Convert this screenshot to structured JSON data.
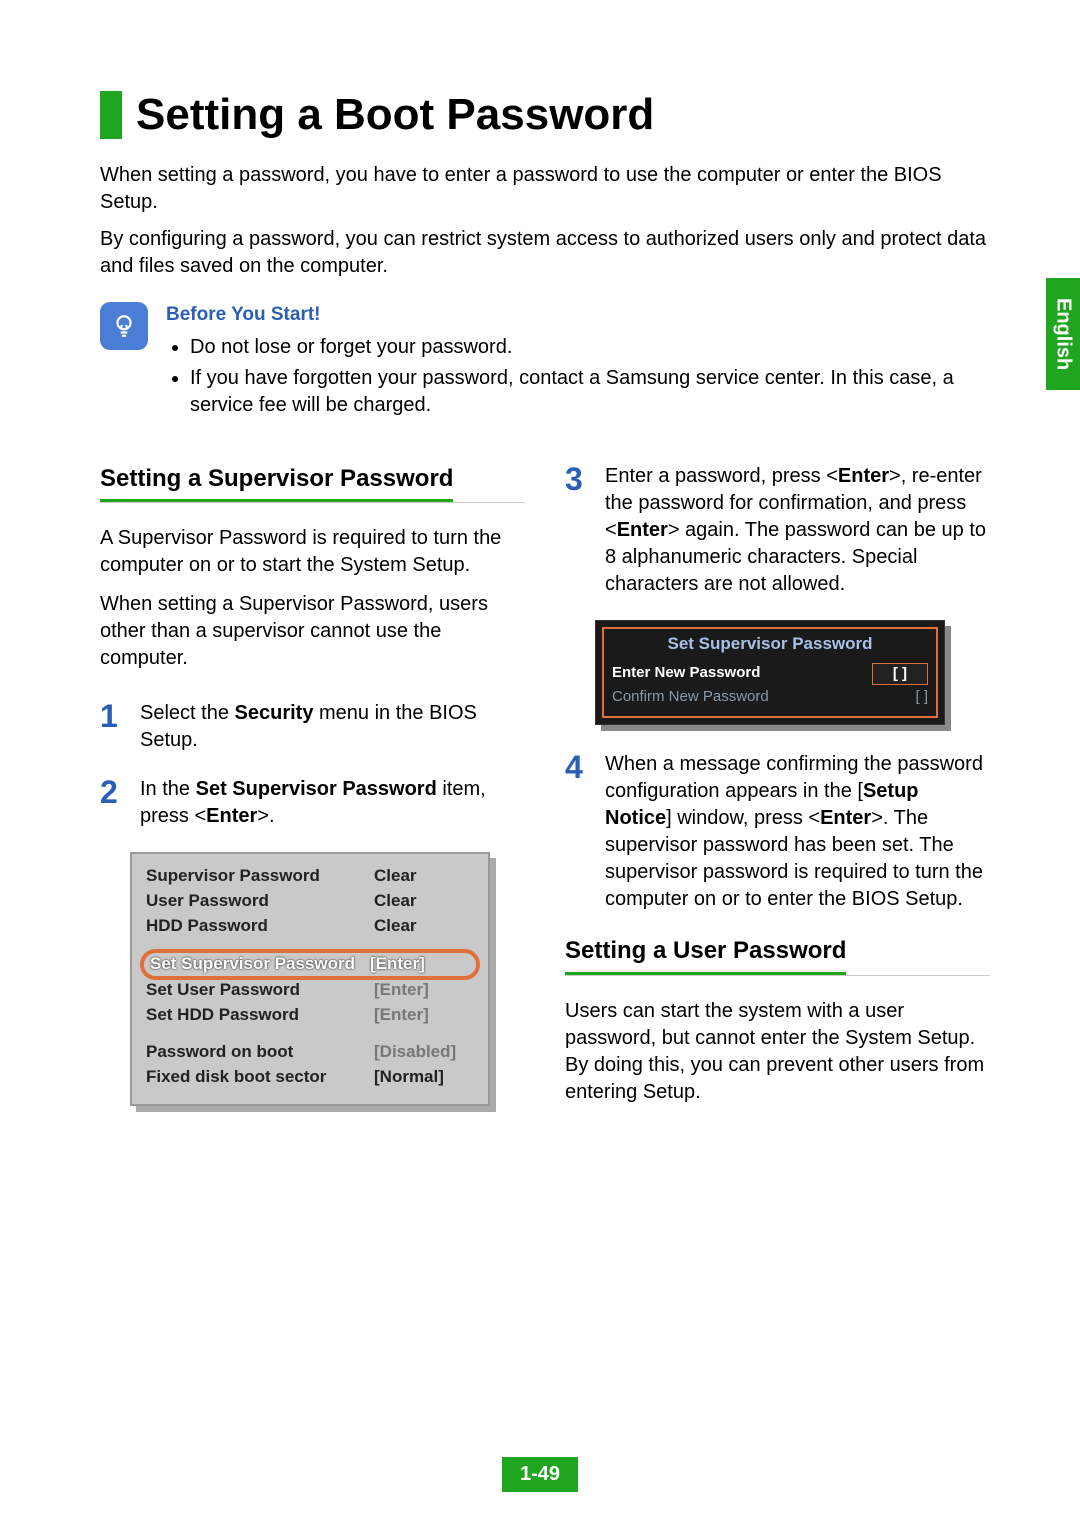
{
  "title": "Setting a Boot Password",
  "intro": {
    "p1": "When setting a password, you have to enter a password to use the computer or enter the BIOS Setup.",
    "p2": "By configuring a password, you can restrict system access to authorized users only and protect data and files saved on the computer."
  },
  "tip": {
    "title": "Before You Start!",
    "b1": "Do not lose or forget your password.",
    "b2": "If you have forgotten your password, contact a Samsung service center. In this case, a service fee will be charged."
  },
  "sideTab": "English",
  "supervisor": {
    "heading": "Setting a Supervisor Password",
    "p1": "A Supervisor Password is required to turn the computer on or to start the System Setup.",
    "p2": "When setting a Supervisor Password, users other than a supervisor cannot use the computer.",
    "step1_a": "Select the ",
    "step1_b": "Security",
    "step1_c": " menu in the BIOS Setup.",
    "step2_a": "In the ",
    "step2_b": "Set Supervisor Password",
    "step2_c": " item, press <",
    "step2_d": "Enter",
    "step2_e": ">."
  },
  "biosFig": {
    "r1l": "Supervisor Password",
    "r1v": "Clear",
    "r2l": "User Password",
    "r2v": "Clear",
    "r3l": "HDD Password",
    "r3v": "Clear",
    "r4l": "Set Supervisor Password",
    "r4v": "[Enter]",
    "r5l": "Set User Password",
    "r5v": "[Enter]",
    "r6l": "Set HDD Password",
    "r6v": "[Enter]",
    "r7l": "Password on boot",
    "r7v": "[Disabled]",
    "r8l": "Fixed disk boot sector",
    "r8v": "[Normal]"
  },
  "right": {
    "step3_a": "Enter a password, press <",
    "step3_b": "Enter",
    "step3_c": ">, re-enter the password for confirmation, and press <",
    "step3_d": "Enter",
    "step3_e": "> again. The password can be up to 8 alphanumeric characters. Special characters are not allowed.",
    "step4_a": "When a message confirming the password configuration appears in the [",
    "step4_b": "Setup Notice",
    "step4_c": "] window, press <",
    "step4_d": "Enter",
    "step4_e": ">. The supervisor password has been set. The supervisor password is required to turn the computer on or to enter the BIOS Setup."
  },
  "dialog": {
    "title": "Set Supervisor Password",
    "r1l": "Enter New Password",
    "r1v": "[            ]",
    "r2l": "Confirm New Password",
    "r2v": "[            ]"
  },
  "user": {
    "heading": "Setting a User Password",
    "p1": "Users can start the system with a user password, but cannot enter the System Setup. By doing this, you can prevent other users from entering Setup."
  },
  "pageNum": "1-49"
}
